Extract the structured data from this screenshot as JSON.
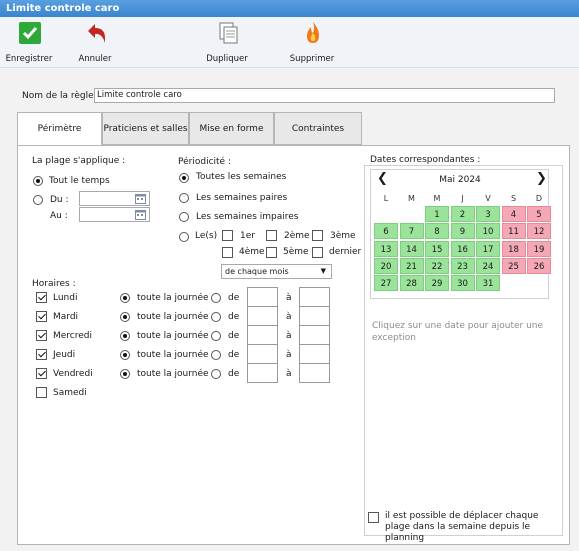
{
  "window": {
    "title": "Limite controle caro"
  },
  "toolbar": {
    "save_label": "Enregistrer",
    "cancel_label": "Annuler",
    "duplicate_label": "Dupliquer",
    "delete_label": "Supprimer"
  },
  "rule": {
    "name_label": "Nom de la règle :",
    "name_value": "Limite controle caro"
  },
  "tabs": [
    "Périmètre",
    "Praticiens et salles",
    "Mise en forme",
    "Contraintes"
  ],
  "plage": {
    "label": "La plage s'applique :",
    "tout_le_temps": "Tout le temps",
    "du": "Du :",
    "au": "Au :"
  },
  "periodicite": {
    "label": "Périodicité :",
    "options": [
      "Toutes les semaines",
      "Les semaines paires",
      "Les semaines impaires",
      "Le(s)"
    ],
    "weeks": [
      "1er",
      "2ème",
      "3ème",
      "4ème",
      "5ème",
      "dernier"
    ],
    "month_select": "de chaque mois"
  },
  "horaires": {
    "label": "Horaires :",
    "toute_journee": "toute la journée",
    "de": "de",
    "a": "à",
    "days": [
      "Lundi",
      "Mardi",
      "Mercredi",
      "Jeudi",
      "Vendredi",
      "Samedi"
    ]
  },
  "dates": {
    "label": "Dates correspondantes :",
    "month": "Mai 2024",
    "weekdays": [
      "L",
      "M",
      "M",
      "J",
      "V",
      "S",
      "D"
    ],
    "hint": "Cliquez sur une date pour ajouter une exception",
    "footer_checkbox": "il est possible de déplacer chaque plage dans la semaine depuis le planning"
  },
  "colors": {
    "titlebar": "#3a84cf",
    "weekday_green": "#9be39b",
    "weekend_red": "#f4a7b4"
  }
}
